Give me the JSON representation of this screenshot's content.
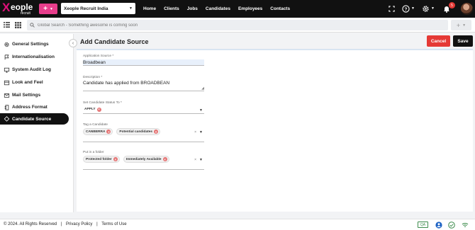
{
  "brand": {
    "logo_word": "eople",
    "logo_sub": "recruit",
    "accent": "#e83e8c"
  },
  "top": {
    "company": "Xeople Recruit India",
    "nav": [
      "Home",
      "Clients",
      "Jobs",
      "Candidates",
      "Employees",
      "Contacts"
    ],
    "notification_count": "5"
  },
  "search": {
    "placeholder": "Global Search - Something awesome is coming soon"
  },
  "sidebar": {
    "items": [
      {
        "label": "General Settings",
        "icon": "settings-icon"
      },
      {
        "label": "Internationalisation",
        "icon": "flag-icon"
      },
      {
        "label": "System Audit Log",
        "icon": "monitor-icon"
      },
      {
        "label": "Look and Feel",
        "icon": "paint-icon"
      },
      {
        "label": "Mail Settings",
        "icon": "mail-icon"
      },
      {
        "label": "Address Format",
        "icon": "address-icon"
      },
      {
        "label": "Candidate Source",
        "icon": "source-icon",
        "active": true
      }
    ]
  },
  "page": {
    "title": "Add Candidate Source",
    "cancel_label": "Cancel",
    "save_label": "Save"
  },
  "form": {
    "application_source": {
      "label": "Application Source *",
      "value": "Broadbean"
    },
    "description": {
      "label": "Description *",
      "value": "Candidate has applied from BROADBEAN"
    },
    "status": {
      "label": "Set Candidate Status To *",
      "chip": "APPLY"
    },
    "tag": {
      "label": "Tag a Candidate",
      "chips": [
        "CANBERRA",
        "Potential candidates"
      ]
    },
    "folder": {
      "label": "Put in a folder",
      "chips": [
        "Protected folder",
        "Immediately Available"
      ]
    }
  },
  "footer": {
    "copyright": "© 2024. All Rights Reserved",
    "sep": "|",
    "privacy": "Privacy Policy",
    "terms": "Terms of Use",
    "qa": "QA"
  }
}
